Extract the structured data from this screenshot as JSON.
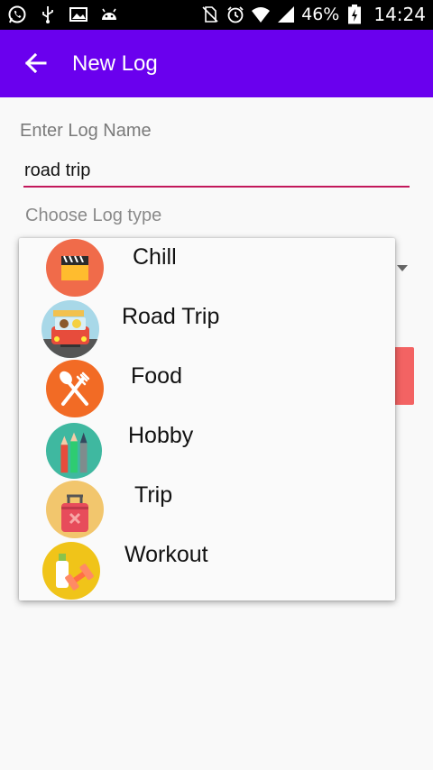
{
  "status_bar": {
    "battery_percent": "46%",
    "time": "14:24",
    "left_icons": [
      "whatsapp-icon",
      "usb-icon",
      "gallery-icon",
      "android-icon"
    ],
    "right_icons": [
      "no-sim-icon",
      "alarm-icon",
      "wifi-icon",
      "signal-icon",
      "battery-charging-icon"
    ]
  },
  "app_bar": {
    "title": "New Log",
    "back_icon": "arrow-left-icon",
    "background": "#6a00ee"
  },
  "form": {
    "name_label": "Enter Log Name",
    "name_value": "road trip",
    "type_label": "Choose Log type",
    "accent": "#c2185b"
  },
  "log_types": [
    {
      "label": "Chill",
      "icon": "clapperboard-icon"
    },
    {
      "label": "Road Trip",
      "icon": "car-icon"
    },
    {
      "label": "Food",
      "icon": "fork-spoon-icon"
    },
    {
      "label": "Hobby",
      "icon": "pencils-icon"
    },
    {
      "label": "Trip",
      "icon": "suitcase-icon"
    },
    {
      "label": "Workout",
      "icon": "dumbbell-bottle-icon"
    }
  ]
}
